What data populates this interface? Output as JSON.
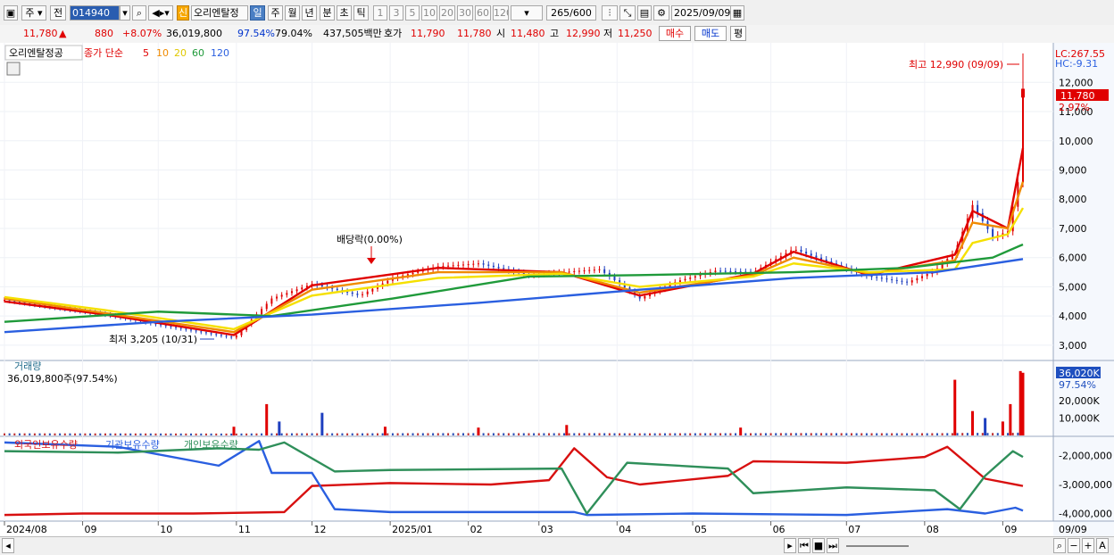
{
  "toolbar": {
    "market": "주",
    "prev_label": "전",
    "code": "014940",
    "new_badge": "신",
    "name": "오리엔탈정",
    "periods": [
      "일",
      "주",
      "월",
      "년",
      "분",
      "초",
      "틱"
    ],
    "selected_period": "일",
    "ticks": [
      "1",
      "3",
      "5",
      "10",
      "20",
      "30",
      "60",
      "120"
    ],
    "count": "265",
    "count_total": "/600",
    "date": "2025/09/09"
  },
  "quote": {
    "price": "11,780",
    "arrow": "▲",
    "change": "880",
    "change_pct": "+8.07%",
    "volume": "36,019,800",
    "vol_ratio": "97.54%",
    "turnover": "79.04%",
    "amount": "437,505백만",
    "hoga_label": "호가",
    "ask": "11,790",
    "bid": "11,780",
    "open_label": "시",
    "open": "11,480",
    "high_label": "고",
    "high": "12,990",
    "low_label": "저",
    "low": "11,250",
    "buy_label": "매수",
    "sell_label": "매도",
    "eval_label": "평"
  },
  "panel_labels": {
    "stock": "오리엔탈정공",
    "ma_title": "종가 단순",
    "ma_periods": [
      "5",
      "10",
      "20",
      "60",
      "120"
    ],
    "volume_title": "거래량",
    "volume_value": "36,019,800주(97.54%)",
    "holding_titles": [
      "외국인보유수량",
      "기관보유수량",
      "개인보유수량"
    ]
  },
  "price_right": {
    "lc": "LC:267.55",
    "hc": "HC:-9.31",
    "last": "11,780",
    "pct": "2.97%",
    "vol_last": "36,020K",
    "vol_pct": "97.54%"
  },
  "annotations": {
    "high": "최고 12,990 (09/09)",
    "low": "최저 3,205 (10/31)",
    "dividend": "배당락(0.00%)"
  },
  "bottom": {
    "date_cursor": "09/09"
  },
  "colors": {
    "up": "#e00000",
    "down": "#1e3fbf",
    "ma5": "#e00000",
    "ma10": "#f08a00",
    "ma20": "#f5e000",
    "ma60": "#1f9a3a",
    "ma120": "#2a5fe0"
  },
  "chart_data": [
    {
      "type": "line",
      "title": "",
      "x_type": "date",
      "x_ticks": [
        "2024/08",
        "09",
        "10",
        "11",
        "12",
        "2025/01",
        "02",
        "03",
        "04",
        "05",
        "06",
        "07",
        "08",
        "09"
      ],
      "y_ticks": [
        3000,
        4000,
        5000,
        6000,
        7000,
        8000,
        9000,
        10000,
        11000,
        12000
      ],
      "ylim": [
        2600,
        13200
      ],
      "series": [
        {
          "name": "종가",
          "color": "#e00000",
          "x": [
            "2024-08-01",
            "2024-08-20",
            "2024-09-10",
            "2024-10-01",
            "2024-10-31",
            "2024-11-15",
            "2024-12-01",
            "2024-12-20",
            "2025-01-02",
            "2025-01-20",
            "2025-02-05",
            "2025-02-25",
            "2025-03-10",
            "2025-03-25",
            "2025-04-10",
            "2025-04-25",
            "2025-05-10",
            "2025-05-25",
            "2025-06-10",
            "2025-06-25",
            "2025-07-10",
            "2025-07-25",
            "2025-08-05",
            "2025-08-13",
            "2025-08-20",
            "2025-08-28",
            "2025-09-03",
            "2025-09-08",
            "2025-09-09"
          ],
          "y": [
            4550,
            4300,
            4050,
            3700,
            3250,
            4600,
            5100,
            4700,
            5300,
            5700,
            5800,
            5400,
            5500,
            5600,
            4600,
            5200,
            5550,
            5500,
            6300,
            5800,
            5350,
            5150,
            5550,
            6200,
            7800,
            6700,
            6900,
            9000,
            11780
          ]
        },
        {
          "name": "5",
          "color": "#e00000",
          "x": [
            "2024-08-01",
            "2024-09-10",
            "2024-10-31",
            "2024-12-01",
            "2025-01-20",
            "2025-03-10",
            "2025-04-10",
            "2025-05-25",
            "2025-06-10",
            "2025-07-10",
            "2025-08-13",
            "2025-08-20",
            "2025-09-03",
            "2025-09-09"
          ],
          "y": [
            4500,
            4050,
            3350,
            5050,
            5650,
            5500,
            4700,
            5450,
            6200,
            5400,
            6100,
            7600,
            7000,
            9750
          ]
        },
        {
          "name": "10",
          "color": "#f08a00",
          "x": [
            "2024-08-01",
            "2024-09-10",
            "2024-10-31",
            "2024-12-01",
            "2025-01-20",
            "2025-03-10",
            "2025-04-10",
            "2025-05-25",
            "2025-06-10",
            "2025-07-10",
            "2025-08-13",
            "2025-08-20",
            "2025-09-03",
            "2025-09-09"
          ],
          "y": [
            4600,
            4100,
            3450,
            4900,
            5500,
            5500,
            4800,
            5400,
            6000,
            5450,
            5900,
            7200,
            7000,
            8600
          ]
        },
        {
          "name": "20",
          "color": "#f5e000",
          "x": [
            "2024-08-01",
            "2024-09-10",
            "2024-10-31",
            "2024-12-01",
            "2025-01-20",
            "2025-03-10",
            "2025-04-10",
            "2025-05-25",
            "2025-06-10",
            "2025-07-10",
            "2025-08-13",
            "2025-08-20",
            "2025-09-03",
            "2025-09-09"
          ],
          "y": [
            4650,
            4200,
            3550,
            4700,
            5300,
            5450,
            5000,
            5350,
            5800,
            5500,
            5600,
            6500,
            6800,
            7700
          ]
        },
        {
          "name": "60",
          "color": "#1f9a3a",
          "x": [
            "2024-08-01",
            "2024-10-01",
            "2024-11-15",
            "2025-01-02",
            "2025-02-25",
            "2025-04-10",
            "2025-06-10",
            "2025-07-25",
            "2025-08-28",
            "2025-09-09"
          ],
          "y": [
            3800,
            4150,
            4000,
            4600,
            5350,
            5400,
            5500,
            5650,
            6000,
            6450
          ]
        },
        {
          "name": "120",
          "color": "#2a5fe0",
          "x": [
            "2024-08-01",
            "2024-10-01",
            "2024-12-01",
            "2025-02-05",
            "2025-04-10",
            "2025-06-10",
            "2025-08-05",
            "2025-09-09"
          ],
          "y": [
            3450,
            3800,
            4050,
            4450,
            4900,
            5300,
            5500,
            5950
          ]
        }
      ]
    },
    {
      "type": "bar",
      "title": "",
      "yaxis_ticks": [
        "10,000K",
        "20,000K"
      ],
      "ylim": [
        0,
        40000
      ],
      "x": [
        "2024-10-31",
        "2024-11-13",
        "2024-11-18",
        "2024-12-05",
        "2024-12-30",
        "2025-02-05",
        "2025-03-12",
        "2025-05-20",
        "2025-08-13",
        "2025-08-20",
        "2025-08-25",
        "2025-09-01",
        "2025-09-04",
        "2025-09-08",
        "2025-09-09"
      ],
      "values": [
        5000,
        18000,
        8000,
        13000,
        5000,
        4500,
        6000,
        4500,
        32000,
        14000,
        10000,
        8000,
        18000,
        37000,
        36020
      ],
      "series_colors": [
        "#e00000",
        "#e00000",
        "#1e3fbf",
        "#1e3fbf",
        "#e00000",
        "#e00000",
        "#e00000",
        "#e00000",
        "#e00000",
        "#e00000",
        "#1e3fbf",
        "#e00000",
        "#e00000",
        "#e00000",
        "#e00000"
      ]
    },
    {
      "type": "line",
      "title": "",
      "y_ticks": [
        -2000000,
        -3000000,
        -4000000
      ],
      "ylim": [
        -4200000,
        -1400000
      ],
      "series": [
        {
          "name": "외국인보유수량",
          "color": "#d81010",
          "x": [
            "2024-08-01",
            "2024-09-01",
            "2024-10-15",
            "2024-11-20",
            "2024-12-01",
            "2025-01-01",
            "2025-02-10",
            "2025-03-05",
            "2025-03-15",
            "2025-03-28",
            "2025-04-10",
            "2025-05-15",
            "2025-05-25",
            "2025-07-01",
            "2025-08-01",
            "2025-08-10",
            "2025-08-25",
            "2025-09-09"
          ],
          "y": [
            -4050000,
            -4000000,
            -4000000,
            -3950000,
            -3050000,
            -2950000,
            -3000000,
            -2850000,
            -1750000,
            -2750000,
            -3000000,
            -2700000,
            -2200000,
            -2250000,
            -2050000,
            -1700000,
            -2800000,
            -3050000
          ]
        },
        {
          "name": "기관보유수량",
          "color": "#2a5fe0",
          "x": [
            "2024-08-01",
            "2024-09-15",
            "2024-10-25",
            "2024-11-10",
            "2024-11-15",
            "2024-12-01",
            "2024-12-10",
            "2025-01-01",
            "2025-03-15",
            "2025-03-20",
            "2025-05-01",
            "2025-07-01",
            "2025-08-10",
            "2025-08-25",
            "2025-09-06",
            "2025-09-09"
          ],
          "y": [
            -1550000,
            -1700000,
            -2350000,
            -1500000,
            -2600000,
            -2600000,
            -3850000,
            -3950000,
            -3950000,
            -4050000,
            -4000000,
            -4050000,
            -3850000,
            -4000000,
            -3800000,
            -3900000
          ]
        },
        {
          "name": "개인보유수량",
          "color": "#2f8f5a",
          "x": [
            "2024-08-01",
            "2024-09-15",
            "2024-10-25",
            "2024-11-10",
            "2024-11-20",
            "2024-12-10",
            "2025-01-01",
            "2025-03-10",
            "2025-03-20",
            "2025-04-05",
            "2025-05-15",
            "2025-05-25",
            "2025-07-01",
            "2025-08-05",
            "2025-08-15",
            "2025-08-25",
            "2025-09-05",
            "2025-09-09"
          ],
          "y": [
            -1850000,
            -1900000,
            -1750000,
            -1800000,
            -1550000,
            -2550000,
            -2500000,
            -2450000,
            -4000000,
            -2250000,
            -2450000,
            -3300000,
            -3100000,
            -3200000,
            -3850000,
            -2700000,
            -1850000,
            -2050000
          ]
        }
      ]
    }
  ]
}
